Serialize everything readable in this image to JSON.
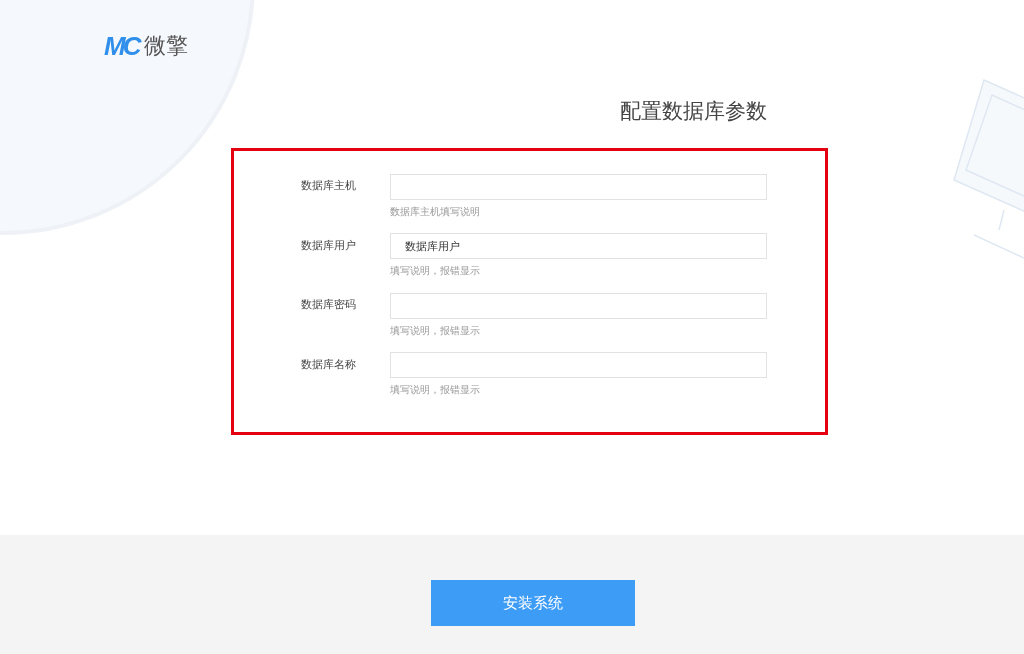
{
  "logo": {
    "mark": "MC",
    "name": "微擎"
  },
  "title": "配置数据库参数",
  "fields": [
    {
      "label": "数据库主机",
      "help": "数据库主机填写说明"
    },
    {
      "label": "数据库用户",
      "value": "数据库用户",
      "help": "填写说明，报错显示"
    },
    {
      "label": "数据库密码",
      "help": "填写说明，报错显示"
    },
    {
      "label": "数据库名称",
      "help": "填写说明，报错显示"
    }
  ],
  "submit": "安装系统"
}
